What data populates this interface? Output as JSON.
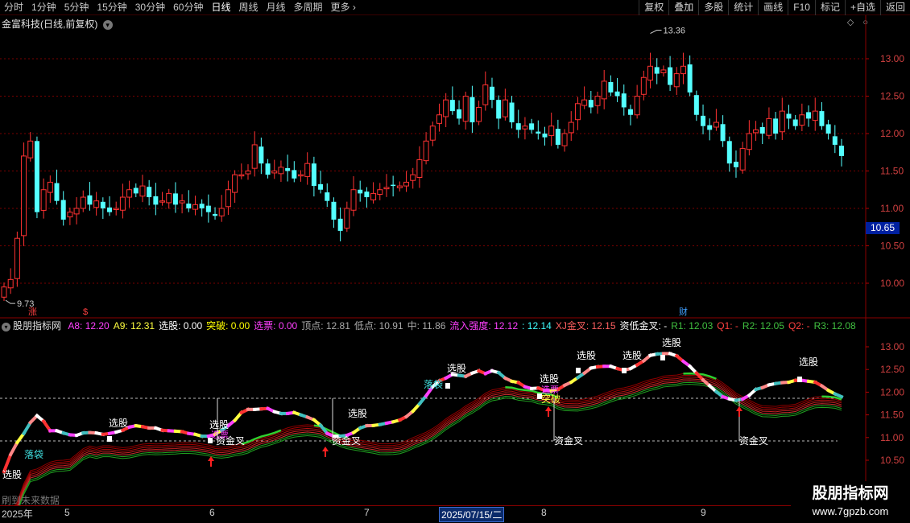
{
  "toolbar": {
    "periods": [
      "分时",
      "1分钟",
      "5分钟",
      "15分钟",
      "30分钟",
      "60分钟",
      "日线",
      "周线",
      "月线",
      "多周期",
      "更多"
    ],
    "active_period": "日线",
    "buttons": [
      "复权",
      "叠加",
      "多股",
      "统计",
      "画线",
      "F10",
      "标记",
      "+自选",
      "返回"
    ]
  },
  "main_chart": {
    "title": "金富科技(日线,前复权)",
    "high_label": "13.36",
    "low_label": "9.73",
    "current_price": "10.65",
    "price_ticks": [
      "13.00",
      "12.50",
      "12.00",
      "11.50",
      "11.00",
      "10.50",
      "10.00"
    ],
    "markers": [
      {
        "text": "涨",
        "color": "#ff4040"
      },
      {
        "text": "$",
        "color": "#ff4040"
      },
      {
        "text": "财",
        "color": "#40a0ff"
      }
    ]
  },
  "indicator": {
    "name": "股朋指标网",
    "fields": [
      {
        "label": "A8:",
        "value": "12.20",
        "color": "#ff40ff"
      },
      {
        "label": "A9:",
        "value": "12.31",
        "color": "#ffff40"
      },
      {
        "label": "选股:",
        "value": "0.00",
        "color": "#ffffff"
      },
      {
        "label": "突破:",
        "value": "0.00",
        "color": "#ffff00"
      },
      {
        "label": "选票:",
        "value": "0.00",
        "color": "#ff40ff"
      },
      {
        "label": "顶点:",
        "value": "12.81",
        "color": "#aaaaaa"
      },
      {
        "label": "低点:",
        "value": "10.91",
        "color": "#aaaaaa"
      },
      {
        "label": "中:",
        "value": "11.86",
        "color": "#aaaaaa"
      },
      {
        "label": "流入强度:",
        "value": "12.12",
        "color": "#ff40ff"
      },
      {
        "label": ":",
        "value": "12.14",
        "color": "#40ffff"
      },
      {
        "label": "XJ金叉:",
        "value": "12.15",
        "color": "#ff6060"
      },
      {
        "label": "资低金叉:",
        "value": "-",
        "color": "#ffffff"
      },
      {
        "label": "R1:",
        "value": "12.03",
        "color": "#40c040"
      },
      {
        "label": "Q1:",
        "value": "-",
        "color": "#ff4040"
      },
      {
        "label": "R2:",
        "value": "12.05",
        "color": "#40c040"
      },
      {
        "label": "Q2:",
        "value": "-",
        "color": "#ff4040"
      },
      {
        "label": "R3:",
        "value": "12.08",
        "color": "#40c040"
      }
    ],
    "price_ticks": [
      "13.00",
      "12.50",
      "12.00",
      "11.50",
      "11.00",
      "10.50"
    ],
    "signals": {
      "xuangu": "选股",
      "luodai": "落袋",
      "zijinjiacha": "资金叉",
      "tupo": "突破",
      "xuanpiao": "选票"
    }
  },
  "footer": {
    "future_data": "刷到未来数据",
    "dates": [
      "2025年",
      "5",
      "6",
      "7",
      "2025/07/15/二",
      "8",
      "9"
    ]
  },
  "watermark": {
    "title": "股朋指标网",
    "url": "www.7gpzb.com"
  },
  "colors": {
    "up": "#ff3232",
    "down": "#54ffff",
    "grid": "#7a0000"
  }
}
